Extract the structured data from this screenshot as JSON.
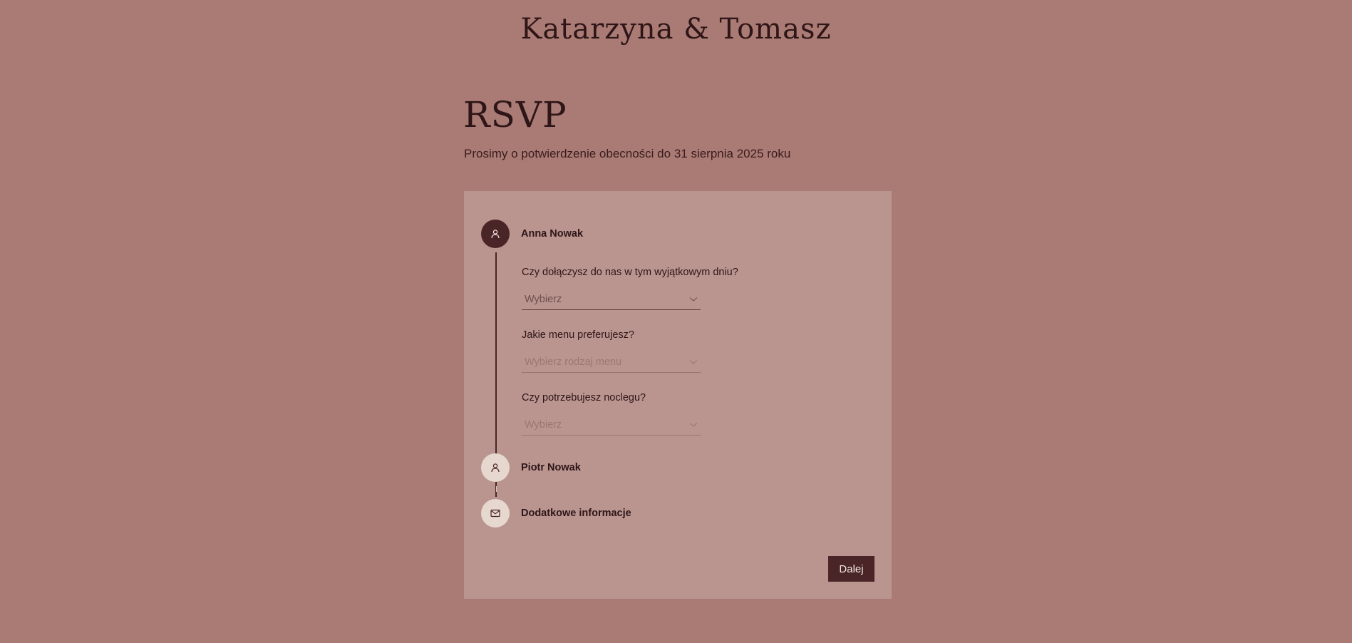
{
  "header": {
    "couple_names": "Katarzyna & Tomasz"
  },
  "rsvp": {
    "title": "RSVP",
    "subtitle": "Prosimy o potwierdzenie obecności do 31 sierpnia 2025 roku"
  },
  "steps": [
    {
      "name": "Anna Nowak",
      "icon": "person-icon",
      "state": "active",
      "questions": [
        {
          "label": "Czy dołączysz do nas w tym wyjątkowym dniu?",
          "placeholder": "Wybierz",
          "enabled": true
        },
        {
          "label": "Jakie menu preferujesz?",
          "placeholder": "Wybierz rodzaj menu",
          "enabled": false
        },
        {
          "label": "Czy potrzebujesz noclegu?",
          "placeholder": "Wybierz",
          "enabled": false
        }
      ]
    },
    {
      "name": "Piotr Nowak",
      "icon": "person-icon",
      "state": "inactive"
    },
    {
      "name": "Dodatkowe informacje",
      "icon": "envelope-icon",
      "state": "inactive"
    }
  ],
  "actions": {
    "next_label": "Dalej"
  },
  "colors": {
    "background": "#aa7b74",
    "card": "#ba958f",
    "accent": "#4a2527",
    "inactive_circle": "#e6d7cf"
  }
}
